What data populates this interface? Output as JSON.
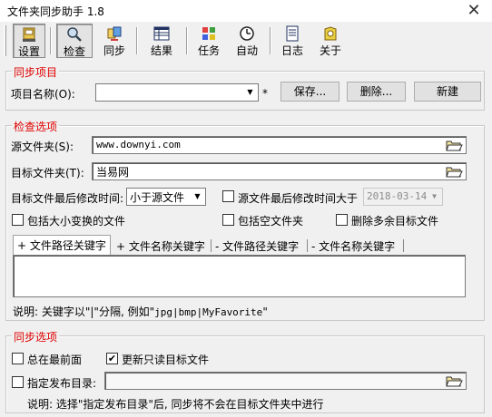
{
  "window": {
    "title": "文件夹同步助手 1.8",
    "close": "✕"
  },
  "toolbar": {
    "items": [
      {
        "label": "设置",
        "icon": "settings-icon"
      },
      {
        "label": "检查",
        "icon": "check-icon"
      },
      {
        "label": "同步",
        "icon": "sync-icon"
      },
      {
        "label": "结果",
        "icon": "results-icon"
      },
      {
        "label": "任务",
        "icon": "tasks-icon"
      },
      {
        "label": "自动",
        "icon": "clock-icon"
      },
      {
        "label": "日志",
        "icon": "log-icon"
      },
      {
        "label": "关于",
        "icon": "about-icon"
      }
    ]
  },
  "sync_project": {
    "title": "同步项目",
    "name_label": "项目名称(O):",
    "name_value": "",
    "required_mark": "*",
    "save_label": "保存...",
    "delete_label": "删除...",
    "new_label": "新建"
  },
  "check_options": {
    "title": "检查选项",
    "source_label": "源文件夹(S):",
    "source_value": "www.downyi.com",
    "target_label": "目标文件夹(T):",
    "target_value": "当易网",
    "target_mtime_label": "目标文件最后修改时间:",
    "target_mtime_value": "小于源文件",
    "source_mtime_label": "源文件最后修改时间大于",
    "source_mtime_value": "2018-03-14",
    "source_mtime_checked": false,
    "case_label": "包括大小变换的文件",
    "case_checked": false,
    "empty_label": "包括空文件夹",
    "empty_checked": false,
    "delete_extra_label": "删除多余目标文件",
    "delete_extra_checked": false,
    "tabs": [
      "+ 文件路径关键字",
      "+ 文件名称关键字",
      "- 文件路径关键字",
      "- 文件名称关键字"
    ],
    "note_prefix": "说明: 关键字以\"|\"分隔, 例如\"",
    "note_example": "jpg|bmp|MyFavorite",
    "note_suffix": "\""
  },
  "sync_options": {
    "title": "同步选项",
    "front_label": "总在最前面",
    "front_checked": false,
    "readonly_label": "更新只读目标文件",
    "readonly_checked": true,
    "publish_label": "指定发布目录:",
    "publish_checked": false,
    "publish_value": "",
    "note": "说明: 选择\"指定发布目录\"后, 同步将不会在目标文件夹中进行"
  }
}
